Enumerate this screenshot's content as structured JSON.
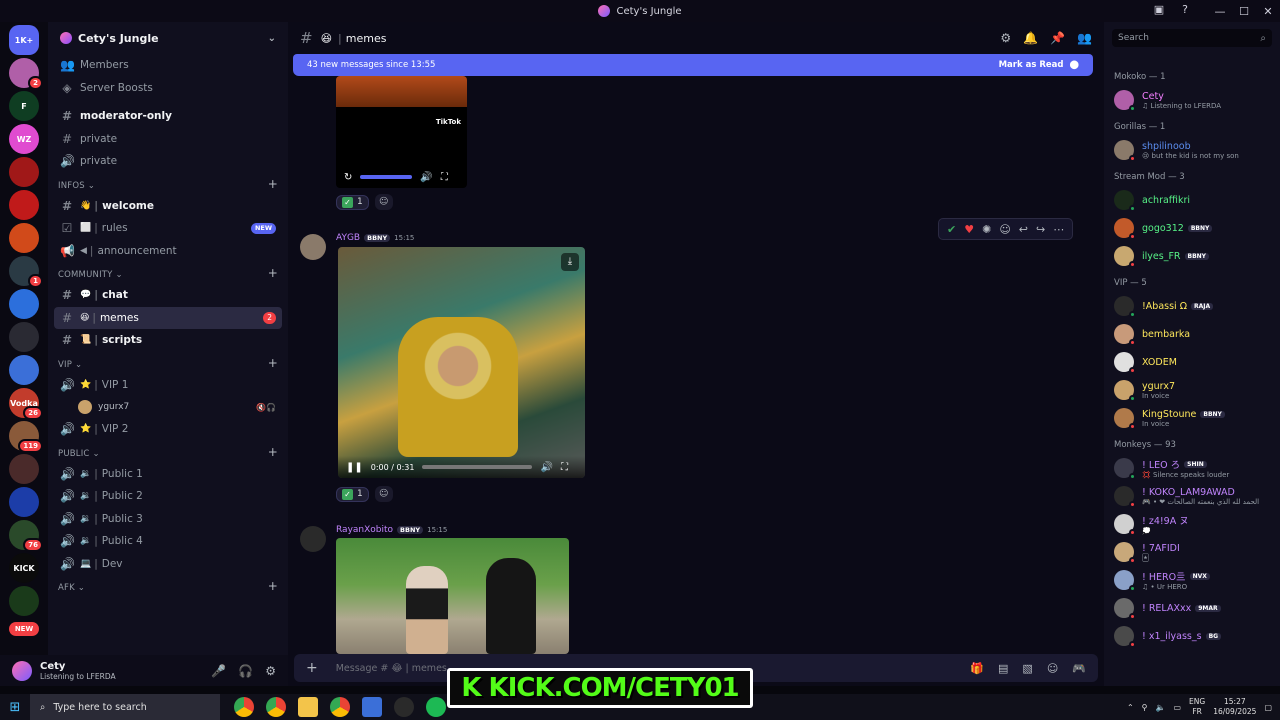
{
  "window": {
    "title": "Cety's Jungle",
    "min": "—",
    "max": "☐",
    "close": "✕"
  },
  "servers": [
    {
      "label": "1K+",
      "color": "#5865f2",
      "badge": ""
    },
    {
      "label": "",
      "color": "#b05fa8",
      "badge": "2"
    },
    {
      "label": "F",
      "color": "#0f3d22",
      "badge": ""
    },
    {
      "label": "WZ",
      "color": "#e04bd0",
      "badge": ""
    },
    {
      "label": "",
      "color": "#a01818",
      "badge": ""
    },
    {
      "label": "",
      "color": "#c01a1a",
      "badge": ""
    },
    {
      "label": "",
      "color": "#d14a1a",
      "badge": ""
    },
    {
      "label": "",
      "color": "#2a3a44",
      "badge": "1"
    },
    {
      "label": "",
      "color": "#2c6fdc",
      "badge": ""
    },
    {
      "label": "",
      "color": "#2a2a33",
      "badge": ""
    },
    {
      "label": "",
      "color": "#3b6fd8",
      "badge": ""
    },
    {
      "label": "Vodka",
      "color": "#c23c2c",
      "badge": "26"
    },
    {
      "label": "",
      "color": "#8a5a3a",
      "badge": "119"
    },
    {
      "label": "",
      "color": "#4a2a2a",
      "badge": ""
    },
    {
      "label": "",
      "color": "#1c3da8",
      "badge": ""
    },
    {
      "label": "",
      "color": "#2a4a2a",
      "badge": "76"
    },
    {
      "label": "KICK",
      "color": "#0b0b0b",
      "badge": ""
    },
    {
      "label": "",
      "color": "#1a3a1a",
      "badge": ""
    }
  ],
  "server_new": "NEW",
  "guild": {
    "name": "Cety's Jungle"
  },
  "channels": {
    "members": "Members",
    "boosts": "Server Boosts",
    "moderator": "moderator-only",
    "private1": "private",
    "private2": "private",
    "cat_infos": "INFOS",
    "welcome": "welcome",
    "rules": "rules",
    "rules_badge": "NEW",
    "announcement": "announcement",
    "cat_community": "COMMUNITY",
    "chat": "chat",
    "memes": "memes",
    "memes_badge": "2",
    "scripts": "scripts",
    "cat_vip": "VIP",
    "vip1": "VIP 1",
    "vip1_member": "ygurx7",
    "vip2": "VIP 2",
    "cat_public": "PUBLIC",
    "public1": "Public 1",
    "public2": "Public 2",
    "public3": "Public 3",
    "public4": "Public 4",
    "dev": "Dev",
    "cat_afk": "AFK"
  },
  "user": {
    "name": "Cety",
    "status": "Listening to LFERDA"
  },
  "chat": {
    "channel": "memes",
    "newbar": "43 new messages since 13:55",
    "mark_read": "Mark as Read",
    "msg1_reaction": "1",
    "msg2_author": "AYGB",
    "msg2_role": "BBNY",
    "msg2_time": "15:15",
    "msg2_video_time": "0:00 / 0:31",
    "msg2_reaction": "1",
    "msg3_author": "RayanXobito",
    "msg3_role": "BBNY",
    "msg3_time": "15:15",
    "tiktok": "TikTok",
    "composer_placeholder": "Message # 😂 | memes"
  },
  "overlay": {
    "kick": "K KICK.COM/CETY01"
  },
  "search": {
    "placeholder": "Search"
  },
  "member_groups": [
    {
      "title": "Mokoko — 1",
      "items": [
        {
          "name": "Cety",
          "color": "#f47fff",
          "sub": "♫ Listening to LFERDA",
          "tag": "",
          "av": "#b05fa8",
          "st": "#23a55a"
        }
      ]
    },
    {
      "title": "Gorillas — 1",
      "items": [
        {
          "name": "shpilinoob",
          "color": "#5b8def",
          "sub": "😢 but the kid is not my son",
          "tag": "",
          "av": "#8a7a6a",
          "st": "#f23f43"
        }
      ]
    },
    {
      "title": "Stream Mod — 3",
      "items": [
        {
          "name": "achraffikri",
          "color": "#57f287",
          "sub": "",
          "tag": "",
          "av": "#1a2a1a",
          "st": "#23a55a"
        },
        {
          "name": "gogo312",
          "color": "#57f287",
          "sub": "",
          "tag": "BBNY",
          "av": "#c25a2a",
          "st": "#f23f43"
        },
        {
          "name": "ilyes_FR",
          "color": "#57f287",
          "sub": "",
          "tag": "BBNY",
          "av": "#c8a870",
          "st": "#f23f43"
        }
      ]
    },
    {
      "title": "VIP — 5",
      "items": [
        {
          "name": "!Abassi Ω",
          "color": "#fee75c",
          "sub": "",
          "tag": "RAJA",
          "av": "#2a2a2a",
          "st": "#23a55a"
        },
        {
          "name": "bembarka",
          "color": "#fee75c",
          "sub": "",
          "tag": "",
          "av": "#c89a7a",
          "st": "#f23f43"
        },
        {
          "name": "XODEM",
          "color": "#fee75c",
          "sub": "",
          "tag": "",
          "av": "#e0e0e0",
          "st": "#f23f43"
        },
        {
          "name": "ygurx7",
          "color": "#fee75c",
          "sub": "In voice",
          "tag": "",
          "av": "#c9a26b",
          "st": "#23a55a"
        },
        {
          "name": "KingStoune",
          "color": "#fee75c",
          "sub": "In voice",
          "tag": "BBNY",
          "av": "#b07a4a",
          "st": "#f23f43"
        }
      ]
    },
    {
      "title": "Monkeys — 93",
      "items": [
        {
          "name": "! LEO ろ",
          "color": "#c084fc",
          "sub": "💢 Silence speaks louder",
          "tag": "SHIN",
          "av": "#3a3a4a",
          "st": "#23a55a"
        },
        {
          "name": "! KOKO_LAM9AWAD",
          "color": "#c084fc",
          "sub": "🎮 • ❤ الحمد لله الذي بنعمته الصالحات",
          "tag": "",
          "av": "#2a2a2a",
          "st": "#f23f43"
        },
        {
          "name": "! z4!9A ヌ",
          "color": "#c084fc",
          "sub": "💭",
          "tag": "",
          "av": "#d0d0d0",
          "st": "#f23f43"
        },
        {
          "name": "! 7AFIDI",
          "color": "#c084fc",
          "sub": "🃏",
          "tag": "",
          "av": "#c8a87a",
          "st": "#f23f43"
        },
        {
          "name": "! HERO亖",
          "color": "#c084fc",
          "sub": "♫ • Ur HERO",
          "tag": "NVX",
          "av": "#8aa0c8",
          "st": "#23a55a"
        },
        {
          "name": "! RELAXxx",
          "color": "#c084fc",
          "sub": "",
          "tag": "9MAR",
          "av": "#6a6a6a",
          "st": "#f23f43"
        },
        {
          "name": "! x1_ilyass_s",
          "color": "#c084fc",
          "sub": "",
          "tag": "BG",
          "av": "#4a4a4a",
          "st": "#f23f43"
        }
      ]
    }
  ],
  "taskbar": {
    "search": "Type here to search",
    "lang1": "ENG",
    "lang2": "FR",
    "time": "15:27",
    "date": "16/09/2025"
  }
}
